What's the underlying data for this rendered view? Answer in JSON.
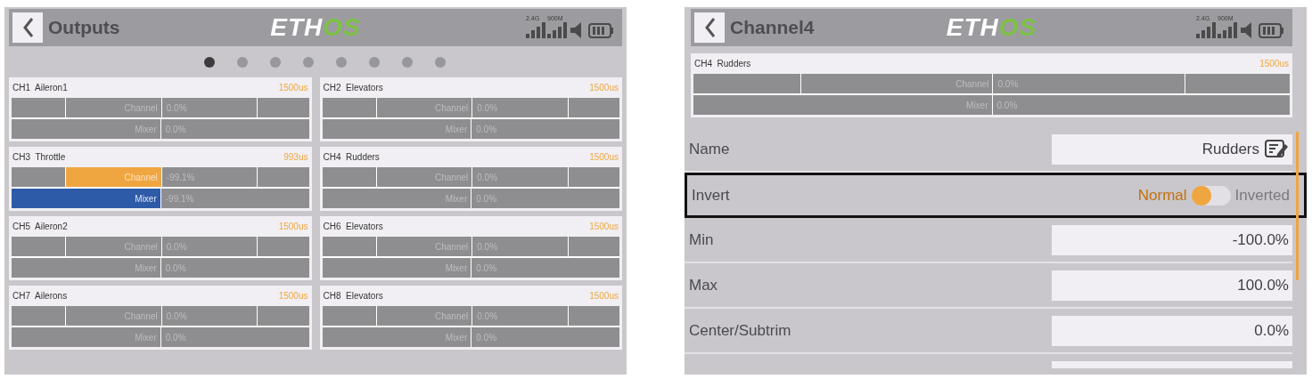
{
  "screens": [
    {
      "kind": "outputs",
      "title": "Outputs",
      "logo": [
        "ETH",
        "OS"
      ],
      "signal_labels": [
        "2.4G",
        "900M"
      ],
      "pages": [
        {
          "selected": true
        },
        {
          "selected": false
        },
        {
          "selected": false
        },
        {
          "selected": false
        },
        {
          "selected": false
        },
        {
          "selected": false
        },
        {
          "selected": false
        },
        {
          "selected": false
        }
      ],
      "channels": [
        {
          "number": "CH1",
          "name": "Aileron1",
          "pulse": "1500us",
          "channel_label": "Channel",
          "channel_value": "0.0%",
          "channel_active": false,
          "mixer_label": "Mixer",
          "mixer_value": "0.0%",
          "mixer_active": false
        },
        {
          "number": "CH2",
          "name": "Elevators",
          "pulse": "1500us",
          "channel_label": "Channel",
          "channel_value": "0.0%",
          "channel_active": false,
          "mixer_label": "Mixer",
          "mixer_value": "0.0%",
          "mixer_active": false
        },
        {
          "number": "CH3",
          "name": "Throttle",
          "pulse": "993us",
          "channel_label": "Channel",
          "channel_value": "-99.1%",
          "channel_active": true,
          "mixer_label": "Mixer",
          "mixer_value": "-99.1%",
          "mixer_active": true
        },
        {
          "number": "CH4",
          "name": "Rudders",
          "pulse": "1500us",
          "channel_label": "Channel",
          "channel_value": "0.0%",
          "channel_active": false,
          "mixer_label": "Mixer",
          "mixer_value": "0.0%",
          "mixer_active": false
        },
        {
          "number": "CH5",
          "name": "Aileron2",
          "pulse": "1500us",
          "channel_label": "Channel",
          "channel_value": "0.0%",
          "channel_active": false,
          "mixer_label": "Mixer",
          "mixer_value": "0.0%",
          "mixer_active": false
        },
        {
          "number": "CH6",
          "name": "Elevators",
          "pulse": "1500us",
          "channel_label": "Channel",
          "channel_value": "0.0%",
          "channel_active": false,
          "mixer_label": "Mixer",
          "mixer_value": "0.0%",
          "mixer_active": false
        },
        {
          "number": "CH7",
          "name": "Ailerons",
          "pulse": "1500us",
          "channel_label": "Channel",
          "channel_value": "0.0%",
          "channel_active": false,
          "mixer_label": "Mixer",
          "mixer_value": "0.0%",
          "mixer_active": false
        },
        {
          "number": "CH8",
          "name": "Elevators",
          "pulse": "1500us",
          "channel_label": "Channel",
          "channel_value": "0.0%",
          "channel_active": false,
          "mixer_label": "Mixer",
          "mixer_value": "0.0%",
          "mixer_active": false
        }
      ]
    },
    {
      "kind": "channel",
      "title": "Channel4",
      "logo": [
        "ETH",
        "OS"
      ],
      "signal_labels": [
        "2.4G",
        "900M"
      ],
      "channels": [
        {
          "number": "CH4",
          "name": "Rudders",
          "pulse": "1500us",
          "channel_label": "Channel",
          "channel_value": "0.0%",
          "channel_active": false,
          "mixer_label": "Mixer",
          "mixer_value": "0.0%",
          "mixer_active": false
        }
      ],
      "fields": [
        {
          "kind": "text",
          "label": "Name",
          "value": "Rudders",
          "selected": false
        },
        {
          "kind": "toggle",
          "label": "Invert",
          "off_label": "Normal",
          "on_label": "Inverted",
          "on": false,
          "selected": true
        },
        {
          "kind": "number",
          "label": "Min",
          "value": "-100.0%",
          "selected": false
        },
        {
          "kind": "number",
          "label": "Max",
          "value": "100.0%",
          "selected": false
        },
        {
          "kind": "number",
          "label": "Center/Subtrim",
          "value": "0.0%",
          "selected": false
        }
      ]
    }
  ]
}
